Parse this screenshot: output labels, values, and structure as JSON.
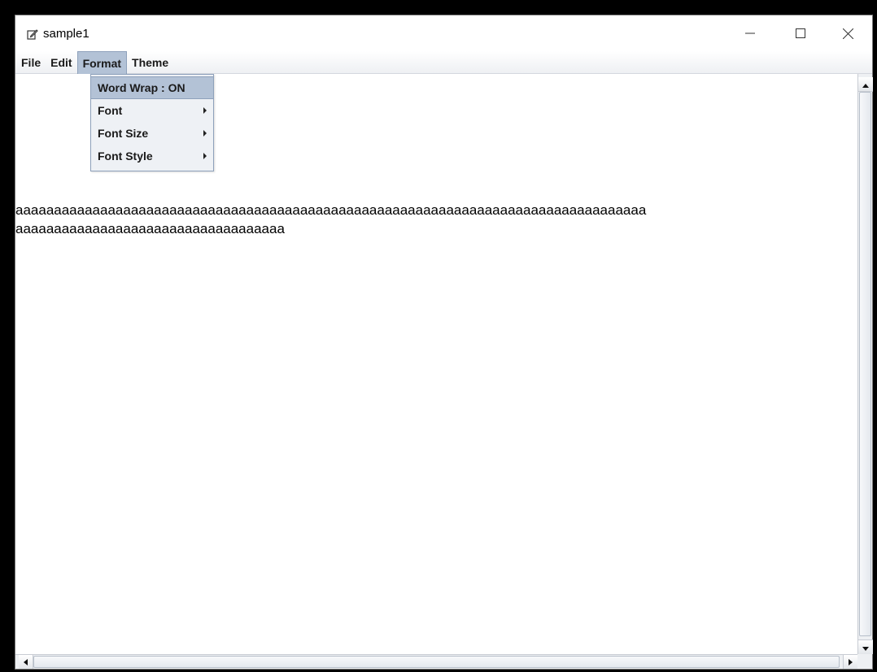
{
  "window": {
    "title": "sample1",
    "title_icon": "edit-icon",
    "controls": {
      "minimize_icon": "minimize-icon",
      "maximize_icon": "maximize-icon",
      "close_icon": "close-icon"
    }
  },
  "menubar": {
    "items": [
      {
        "label": "File"
      },
      {
        "label": "Edit"
      },
      {
        "label": "Format"
      },
      {
        "label": "Theme"
      }
    ],
    "active": "Format"
  },
  "format_menu": {
    "items": [
      {
        "label": "Word Wrap : ON",
        "submenu": false
      },
      {
        "label": "Font",
        "submenu": true
      },
      {
        "label": "Font Size",
        "submenu": true
      },
      {
        "label": "Font Style",
        "submenu": true
      }
    ]
  },
  "editor": {
    "lines": [
      "aaaaaaaaaaaaaaaaaaaaaaaaaaaaaaaaaaaaaaaaaaaaaaaaaaaaaaaaaaaaaaaaaaaaaaaaaaaaaaaaaa",
      "aaaaaaaaaaaaaaaaaaaaaaaaaaaaaaaaaaa"
    ]
  },
  "colors": {
    "menu_highlight": "#b3c2d6",
    "menu_border": "#8ea1bb",
    "menu_background": "#eef1f5"
  }
}
